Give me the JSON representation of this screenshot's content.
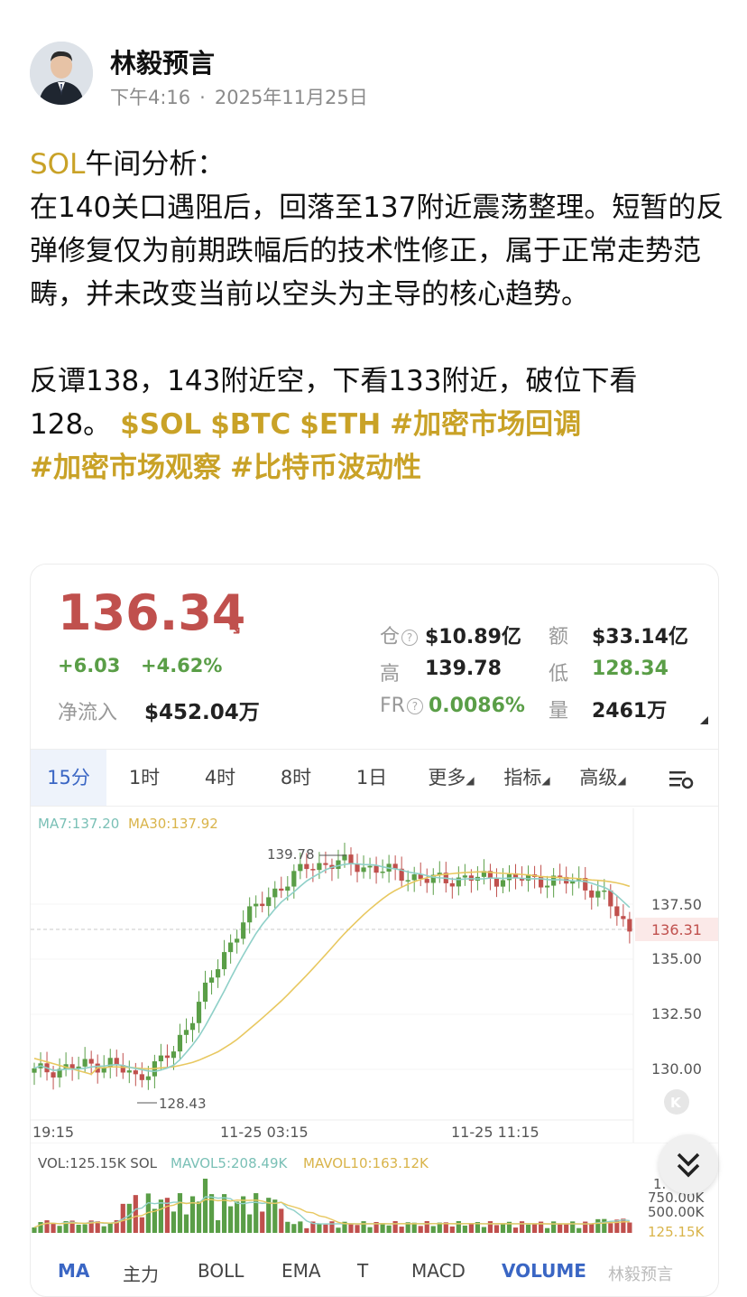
{
  "author": {
    "name": "林毅预言",
    "time": "下午4:16",
    "date": "2025年11月25日"
  },
  "post": {
    "ticker": "SOL",
    "title_rest": "午间分析：",
    "para1": "在140关口遇阻后，回落至137附近震荡整理。短暂的反弹修复仅为前期跌幅后的技术性修正，属于正常走势范畴，并未改变当前以空头为主导的核心趋势。",
    "para2_plain": "反谭138，143附近空，下看133附近，破位下看128。",
    "tags": [
      "$SOL",
      "$BTC",
      "$ETH",
      "#加密市场回调",
      "#加密市场观察",
      "#比特币波动性"
    ]
  },
  "quote": {
    "price": "136.34",
    "arrow": "↘",
    "change": "+6.03",
    "change_pct": "+4.62%",
    "netflow_label": "净流入",
    "netflow_value": "$452.04万",
    "stats": [
      {
        "label": "仓",
        "value": "$10.89亿",
        "q": true,
        "green": false
      },
      {
        "label": "额",
        "value": "$33.14亿",
        "q": false,
        "green": false
      },
      {
        "label": "高",
        "value": "139.78",
        "q": false,
        "green": false
      },
      {
        "label": "低",
        "value": "128.34",
        "q": false,
        "green": true
      },
      {
        "label": "FR",
        "value": "0.0086%",
        "q": true,
        "green": true
      },
      {
        "label": "量",
        "value": "2461万",
        "q": false,
        "green": false
      }
    ]
  },
  "timeframes": [
    "15分",
    "1时",
    "4时",
    "8时",
    "1日",
    "更多",
    "指标",
    "高级"
  ],
  "active_timeframe": "15分",
  "chart": {
    "ma_legend_ma7": "MA7:137.20",
    "ma_legend_ma30": "MA30:137.92",
    "high_label": "139.78",
    "low_label": "128.43",
    "current_price_tag": "136.31",
    "y_ticks": [
      "137.50",
      "135.00",
      "132.50",
      "130.00"
    ],
    "x_ticks": [
      "19:15",
      "11-25 03:15",
      "11-25 11:15"
    ]
  },
  "volume": {
    "legend_vol": "VOL:125.15K SOL",
    "legend_mavol5": "MAVOL5:208.49K",
    "legend_mavol10": "MAVOL10:163.12K",
    "y_ticks": [
      "1.",
      "750.00K",
      "500.00K",
      "125.15K"
    ]
  },
  "indicators": [
    "MA",
    "主力",
    "BOLL",
    "EMA",
    "T",
    "MACD",
    "VOLUME"
  ],
  "active_indicator": "MA",
  "watermark": "林毅预言",
  "colors": {
    "up": "#5a9e47",
    "down": "#c0504d",
    "ma7": "#8fd0c8",
    "ma30": "#e8c860",
    "gold": "#c9a227",
    "accent": "#3a66c4"
  },
  "chart_data": {
    "type": "candlestick",
    "series": [
      {
        "name": "MA7",
        "value": 137.2
      },
      {
        "name": "MA30",
        "value": 137.92
      }
    ],
    "high": 139.78,
    "low": 128.43,
    "last": 136.31,
    "ylim": [
      128.0,
      141.0
    ],
    "y_ticks": [
      137.5,
      135.0,
      132.5,
      130.0
    ],
    "x_ticks": [
      "19:15",
      "11-25 03:15",
      "11-25 11:15"
    ]
  }
}
